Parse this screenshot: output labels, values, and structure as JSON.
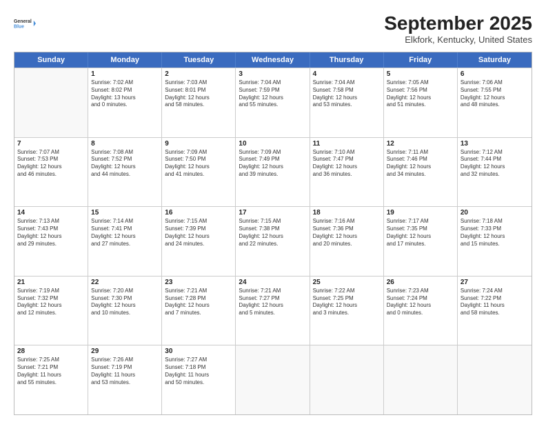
{
  "header": {
    "logo": {
      "line1": "General",
      "line2": "Blue"
    },
    "title": "September 2025",
    "subtitle": "Elkfork, Kentucky, United States"
  },
  "calendar": {
    "days": [
      "Sunday",
      "Monday",
      "Tuesday",
      "Wednesday",
      "Thursday",
      "Friday",
      "Saturday"
    ],
    "weeks": [
      [
        {
          "day": "",
          "empty": true
        },
        {
          "day": "1",
          "line1": "Sunrise: 7:02 AM",
          "line2": "Sunset: 8:02 PM",
          "line3": "Daylight: 13 hours",
          "line4": "and 0 minutes."
        },
        {
          "day": "2",
          "line1": "Sunrise: 7:03 AM",
          "line2": "Sunset: 8:01 PM",
          "line3": "Daylight: 12 hours",
          "line4": "and 58 minutes."
        },
        {
          "day": "3",
          "line1": "Sunrise: 7:04 AM",
          "line2": "Sunset: 7:59 PM",
          "line3": "Daylight: 12 hours",
          "line4": "and 55 minutes."
        },
        {
          "day": "4",
          "line1": "Sunrise: 7:04 AM",
          "line2": "Sunset: 7:58 PM",
          "line3": "Daylight: 12 hours",
          "line4": "and 53 minutes."
        },
        {
          "day": "5",
          "line1": "Sunrise: 7:05 AM",
          "line2": "Sunset: 7:56 PM",
          "line3": "Daylight: 12 hours",
          "line4": "and 51 minutes."
        },
        {
          "day": "6",
          "line1": "Sunrise: 7:06 AM",
          "line2": "Sunset: 7:55 PM",
          "line3": "Daylight: 12 hours",
          "line4": "and 48 minutes."
        }
      ],
      [
        {
          "day": "7",
          "line1": "Sunrise: 7:07 AM",
          "line2": "Sunset: 7:53 PM",
          "line3": "Daylight: 12 hours",
          "line4": "and 46 minutes."
        },
        {
          "day": "8",
          "line1": "Sunrise: 7:08 AM",
          "line2": "Sunset: 7:52 PM",
          "line3": "Daylight: 12 hours",
          "line4": "and 44 minutes."
        },
        {
          "day": "9",
          "line1": "Sunrise: 7:09 AM",
          "line2": "Sunset: 7:50 PM",
          "line3": "Daylight: 12 hours",
          "line4": "and 41 minutes."
        },
        {
          "day": "10",
          "line1": "Sunrise: 7:09 AM",
          "line2": "Sunset: 7:49 PM",
          "line3": "Daylight: 12 hours",
          "line4": "and 39 minutes."
        },
        {
          "day": "11",
          "line1": "Sunrise: 7:10 AM",
          "line2": "Sunset: 7:47 PM",
          "line3": "Daylight: 12 hours",
          "line4": "and 36 minutes."
        },
        {
          "day": "12",
          "line1": "Sunrise: 7:11 AM",
          "line2": "Sunset: 7:46 PM",
          "line3": "Daylight: 12 hours",
          "line4": "and 34 minutes."
        },
        {
          "day": "13",
          "line1": "Sunrise: 7:12 AM",
          "line2": "Sunset: 7:44 PM",
          "line3": "Daylight: 12 hours",
          "line4": "and 32 minutes."
        }
      ],
      [
        {
          "day": "14",
          "line1": "Sunrise: 7:13 AM",
          "line2": "Sunset: 7:43 PM",
          "line3": "Daylight: 12 hours",
          "line4": "and 29 minutes."
        },
        {
          "day": "15",
          "line1": "Sunrise: 7:14 AM",
          "line2": "Sunset: 7:41 PM",
          "line3": "Daylight: 12 hours",
          "line4": "and 27 minutes."
        },
        {
          "day": "16",
          "line1": "Sunrise: 7:15 AM",
          "line2": "Sunset: 7:39 PM",
          "line3": "Daylight: 12 hours",
          "line4": "and 24 minutes."
        },
        {
          "day": "17",
          "line1": "Sunrise: 7:15 AM",
          "line2": "Sunset: 7:38 PM",
          "line3": "Daylight: 12 hours",
          "line4": "and 22 minutes."
        },
        {
          "day": "18",
          "line1": "Sunrise: 7:16 AM",
          "line2": "Sunset: 7:36 PM",
          "line3": "Daylight: 12 hours",
          "line4": "and 20 minutes."
        },
        {
          "day": "19",
          "line1": "Sunrise: 7:17 AM",
          "line2": "Sunset: 7:35 PM",
          "line3": "Daylight: 12 hours",
          "line4": "and 17 minutes."
        },
        {
          "day": "20",
          "line1": "Sunrise: 7:18 AM",
          "line2": "Sunset: 7:33 PM",
          "line3": "Daylight: 12 hours",
          "line4": "and 15 minutes."
        }
      ],
      [
        {
          "day": "21",
          "line1": "Sunrise: 7:19 AM",
          "line2": "Sunset: 7:32 PM",
          "line3": "Daylight: 12 hours",
          "line4": "and 12 minutes."
        },
        {
          "day": "22",
          "line1": "Sunrise: 7:20 AM",
          "line2": "Sunset: 7:30 PM",
          "line3": "Daylight: 12 hours",
          "line4": "and 10 minutes."
        },
        {
          "day": "23",
          "line1": "Sunrise: 7:21 AM",
          "line2": "Sunset: 7:28 PM",
          "line3": "Daylight: 12 hours",
          "line4": "and 7 minutes."
        },
        {
          "day": "24",
          "line1": "Sunrise: 7:21 AM",
          "line2": "Sunset: 7:27 PM",
          "line3": "Daylight: 12 hours",
          "line4": "and 5 minutes."
        },
        {
          "day": "25",
          "line1": "Sunrise: 7:22 AM",
          "line2": "Sunset: 7:25 PM",
          "line3": "Daylight: 12 hours",
          "line4": "and 3 minutes."
        },
        {
          "day": "26",
          "line1": "Sunrise: 7:23 AM",
          "line2": "Sunset: 7:24 PM",
          "line3": "Daylight: 12 hours",
          "line4": "and 0 minutes."
        },
        {
          "day": "27",
          "line1": "Sunrise: 7:24 AM",
          "line2": "Sunset: 7:22 PM",
          "line3": "Daylight: 11 hours",
          "line4": "and 58 minutes."
        }
      ],
      [
        {
          "day": "28",
          "line1": "Sunrise: 7:25 AM",
          "line2": "Sunset: 7:21 PM",
          "line3": "Daylight: 11 hours",
          "line4": "and 55 minutes."
        },
        {
          "day": "29",
          "line1": "Sunrise: 7:26 AM",
          "line2": "Sunset: 7:19 PM",
          "line3": "Daylight: 11 hours",
          "line4": "and 53 minutes."
        },
        {
          "day": "30",
          "line1": "Sunrise: 7:27 AM",
          "line2": "Sunset: 7:18 PM",
          "line3": "Daylight: 11 hours",
          "line4": "and 50 minutes."
        },
        {
          "day": "",
          "empty": true
        },
        {
          "day": "",
          "empty": true
        },
        {
          "day": "",
          "empty": true
        },
        {
          "day": "",
          "empty": true
        }
      ]
    ]
  }
}
